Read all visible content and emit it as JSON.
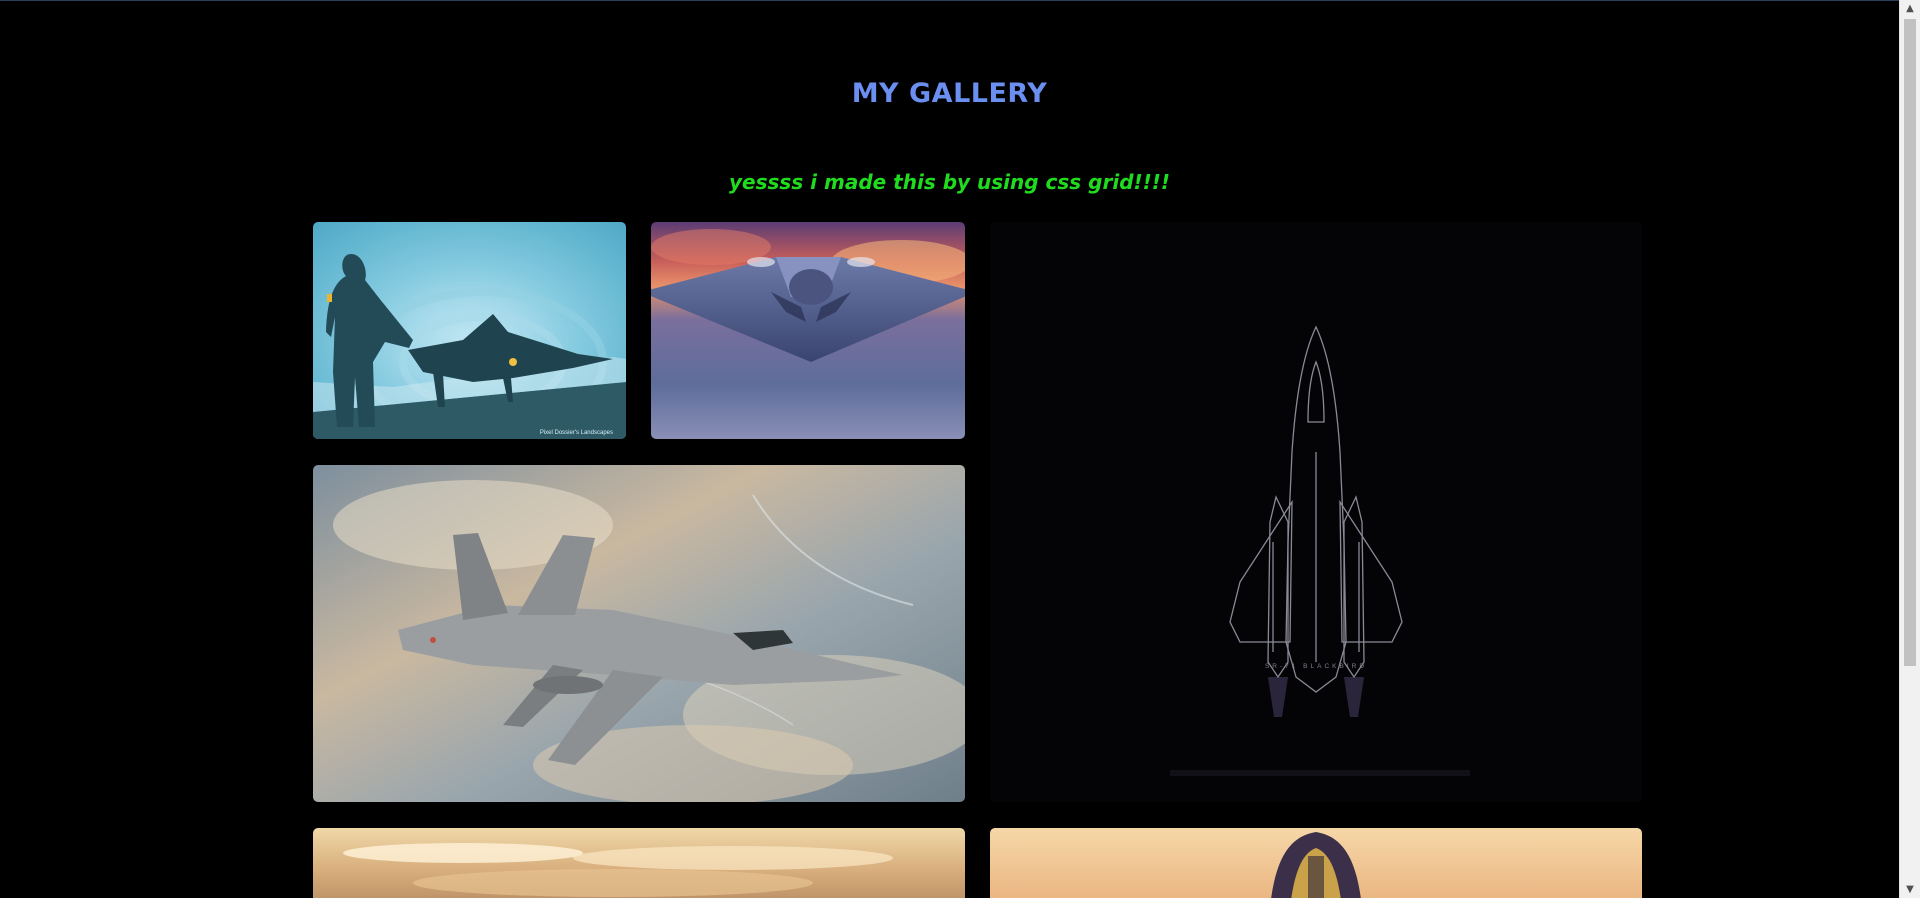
{
  "header": {
    "title": "MY GALLERY",
    "subtitle": "yessss i made this by using css grid!!!!"
  },
  "colors": {
    "background": "#000000",
    "title": "#6a8ff0",
    "subtitle": "#1fdc1f"
  },
  "gallery": {
    "images": [
      {
        "subject": "pilot and jet silhouette",
        "caption": "Pixel Dossier's Landscapes"
      },
      {
        "subject": "stealth bomber over clouds"
      },
      {
        "subject": "SR-71 blueprint",
        "caption": "SR-71 BLACKBIRD"
      },
      {
        "subject": "fighter jet over snowy clouds"
      },
      {
        "subject": "jet above sunset clouds"
      },
      {
        "subject": "jet nose at sunset"
      }
    ]
  },
  "scrollbar": {
    "up_icon": "chevron-up-icon",
    "down_icon": "chevron-down-icon"
  }
}
